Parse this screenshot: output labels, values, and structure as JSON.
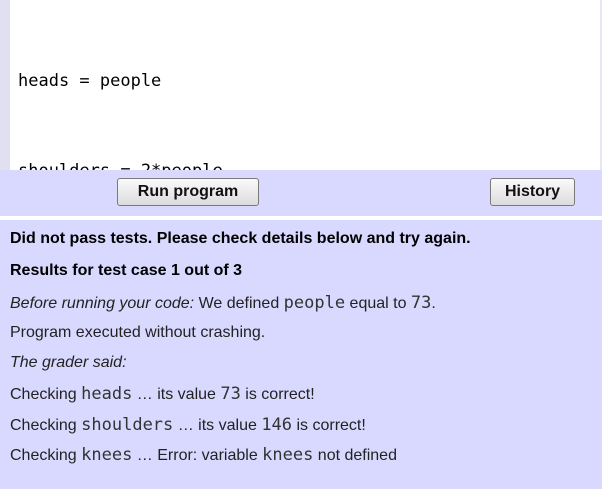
{
  "editor": {
    "lines": [
      "heads = people",
      "shoulders = 2*people"
    ]
  },
  "toolbar": {
    "run_label": "Run program",
    "history_label": "History"
  },
  "results": {
    "summary": "Did not pass tests. Please check details below and try again.",
    "case_header": "Results for test case 1 out of 3",
    "before_prefix": "Before running your code:",
    "before_mid": " We defined ",
    "before_var": "people",
    "before_equal": " equal to ",
    "before_value": "73",
    "before_end": ".",
    "executed": "Program executed without crashing.",
    "grader_said": "The grader said:",
    "checks": [
      {
        "prefix": "Checking ",
        "var": "heads",
        "mid": " … its value ",
        "value": "73",
        "suffix": " is correct!"
      },
      {
        "prefix": "Checking ",
        "var": "shoulders",
        "mid": " … its value ",
        "value": "146",
        "suffix": " is correct!"
      },
      {
        "prefix": "Checking ",
        "var": "knees",
        "mid": " … Error: variable ",
        "value": "knees",
        "suffix": " not defined"
      }
    ]
  }
}
